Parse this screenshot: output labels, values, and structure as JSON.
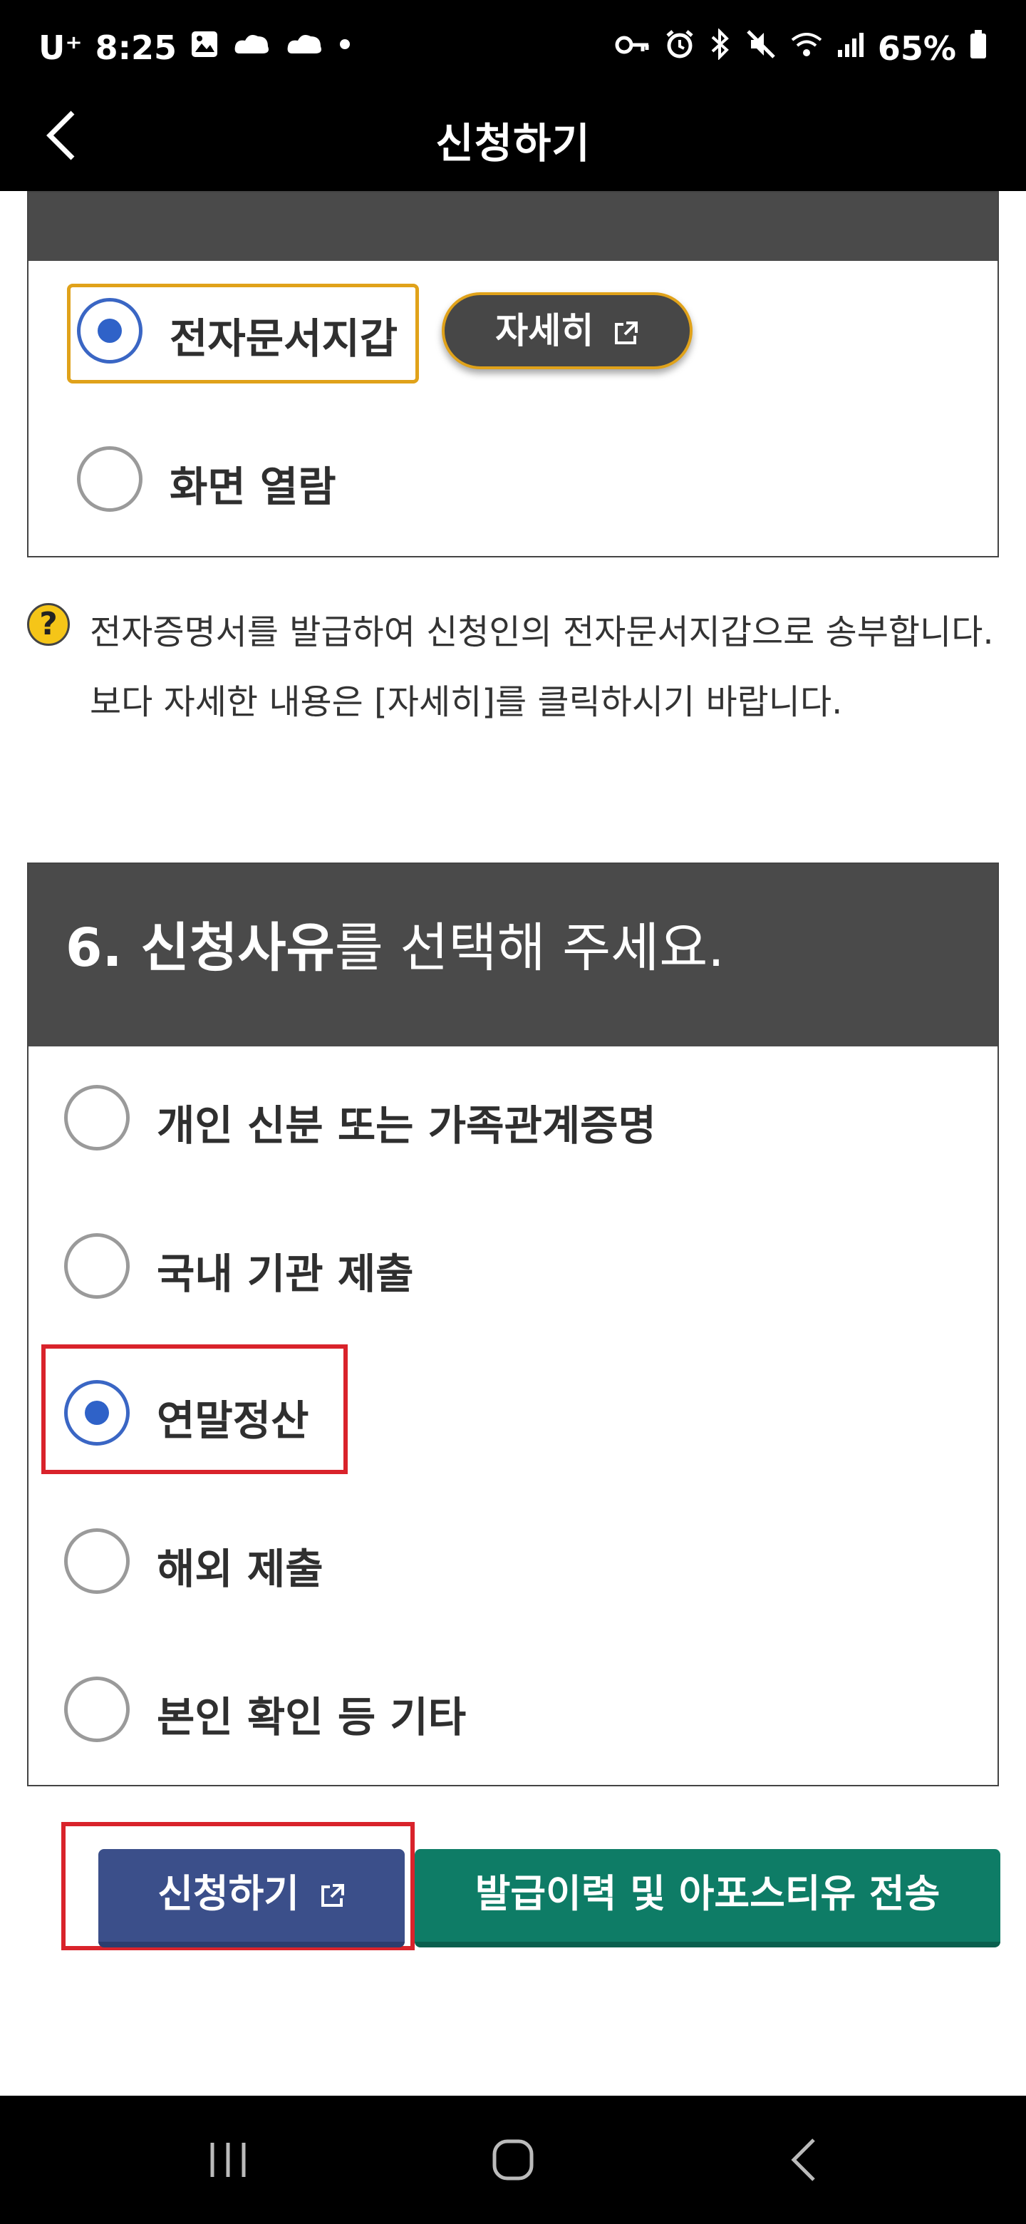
{
  "status_bar": {
    "carrier": "U⁺",
    "time": "8:25",
    "battery": "65%"
  },
  "app_bar": {
    "title": "신청하기"
  },
  "delivery": {
    "options": [
      {
        "label": "전자문서지갑",
        "checked": true
      },
      {
        "label": "화면 열람",
        "checked": false
      }
    ],
    "detail_button": "자세히",
    "help_text": "전자증명서를 발급하여 신청인의 전자문서지갑으로 송부합니다. 보다 자세한 내용은 [자세히]를 클릭하시기 바랍니다."
  },
  "reason_section": {
    "title_prefix": "6. ",
    "title_bold": "신청사유",
    "title_rest": "를 선택해 주세요.",
    "options": [
      {
        "label": "개인 신분 또는 가족관계증명",
        "checked": false
      },
      {
        "label": "국내 기관 제출",
        "checked": false
      },
      {
        "label": "연말정산",
        "checked": true
      },
      {
        "label": "해외 제출",
        "checked": false
      },
      {
        "label": "본인 확인 등 기타",
        "checked": false
      }
    ]
  },
  "actions": {
    "apply_label": "신청하기",
    "history_label": "발급이력 및 아포스티유 전송"
  },
  "colors": {
    "radio_selected": "#2f62c8",
    "apply_button": "#3b4f8a",
    "history_button": "#0e7c66",
    "highlight": "#d9232b",
    "header_bg": "#4a4a4a"
  }
}
